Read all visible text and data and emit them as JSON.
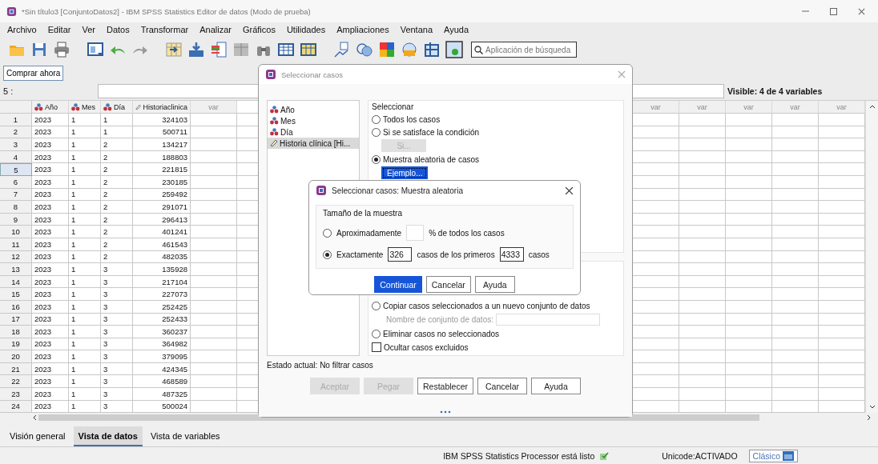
{
  "window": {
    "title": "*Sin título3 [ConjuntoDatos2] - IBM SPSS Statistics Editor de datos (Modo de prueba)"
  },
  "menu": [
    "Archivo",
    "Editar",
    "Ver",
    "Datos",
    "Transformar",
    "Analizar",
    "Gráficos",
    "Utilidades",
    "Ampliaciones",
    "Ventana",
    "Ayuda"
  ],
  "search": {
    "placeholder": "Aplicación de búsqueda"
  },
  "buy_button": "Comprar ahora",
  "cell_editor": {
    "label": "5 :",
    "visible_info": "Visible: 4 de 4 variables"
  },
  "grid": {
    "columns": [
      {
        "name": "Año",
        "kind": "nominal"
      },
      {
        "name": "Mes",
        "kind": "nominal"
      },
      {
        "name": "Día",
        "kind": "nominal"
      },
      {
        "name": "Historiaclinica",
        "kind": "scale"
      },
      {
        "name": "var",
        "kind": "empty"
      }
    ],
    "right_columns": [
      "var",
      "var",
      "var",
      "var",
      "var"
    ],
    "rows": [
      {
        "number": "1",
        "selected": false,
        "cells": [
          "2023",
          "1",
          "1",
          "324103"
        ]
      },
      {
        "number": "2",
        "selected": false,
        "cells": [
          "2023",
          "1",
          "1",
          "500711"
        ]
      },
      {
        "number": "3",
        "selected": false,
        "cells": [
          "2023",
          "1",
          "2",
          "134217"
        ]
      },
      {
        "number": "4",
        "selected": false,
        "cells": [
          "2023",
          "1",
          "2",
          "188803"
        ]
      },
      {
        "number": "5",
        "selected": true,
        "cells": [
          "2023",
          "1",
          "2",
          "221815"
        ]
      },
      {
        "number": "6",
        "selected": false,
        "cells": [
          "2023",
          "1",
          "2",
          "230185"
        ]
      },
      {
        "number": "7",
        "selected": false,
        "cells": [
          "2023",
          "1",
          "2",
          "259492"
        ]
      },
      {
        "number": "8",
        "selected": false,
        "cells": [
          "2023",
          "1",
          "2",
          "291071"
        ]
      },
      {
        "number": "9",
        "selected": false,
        "cells": [
          "2023",
          "1",
          "2",
          "296413"
        ]
      },
      {
        "number": "10",
        "selected": false,
        "cells": [
          "2023",
          "1",
          "2",
          "401241"
        ]
      },
      {
        "number": "11",
        "selected": false,
        "cells": [
          "2023",
          "1",
          "2",
          "461543"
        ]
      },
      {
        "number": "12",
        "selected": false,
        "cells": [
          "2023",
          "1",
          "2",
          "482035"
        ]
      },
      {
        "number": "13",
        "selected": false,
        "cells": [
          "2023",
          "1",
          "3",
          "135928"
        ]
      },
      {
        "number": "14",
        "selected": false,
        "cells": [
          "2023",
          "1",
          "3",
          "217104"
        ]
      },
      {
        "number": "15",
        "selected": false,
        "cells": [
          "2023",
          "1",
          "3",
          "227073"
        ]
      },
      {
        "number": "16",
        "selected": false,
        "cells": [
          "2023",
          "1",
          "3",
          "252425"
        ]
      },
      {
        "number": "17",
        "selected": false,
        "cells": [
          "2023",
          "1",
          "3",
          "252433"
        ]
      },
      {
        "number": "18",
        "selected": false,
        "cells": [
          "2023",
          "1",
          "3",
          "360237"
        ]
      },
      {
        "number": "19",
        "selected": false,
        "cells": [
          "2023",
          "1",
          "3",
          "364982"
        ]
      },
      {
        "number": "20",
        "selected": false,
        "cells": [
          "2023",
          "1",
          "3",
          "379095"
        ]
      },
      {
        "number": "21",
        "selected": false,
        "cells": [
          "2023",
          "1",
          "3",
          "424345"
        ]
      },
      {
        "number": "22",
        "selected": false,
        "cells": [
          "2023",
          "1",
          "3",
          "468589"
        ]
      },
      {
        "number": "23",
        "selected": false,
        "cells": [
          "2023",
          "1",
          "3",
          "487325"
        ]
      },
      {
        "number": "24",
        "selected": false,
        "cells": [
          "2023",
          "1",
          "3",
          "500024"
        ]
      }
    ]
  },
  "view_tabs": [
    {
      "label": "Visión general",
      "selected": false
    },
    {
      "label": "Vista de datos",
      "selected": true
    },
    {
      "label": "Vista de variables",
      "selected": false
    }
  ],
  "status_bar": {
    "processor": "IBM SPSS Statistics Processor está listo",
    "unicode": "Unicode:ACTIVADO",
    "mode_button": "Clásico"
  },
  "select_cases_dialog": {
    "title": "Seleccionar casos",
    "variables": [
      {
        "label": "Año",
        "kind": "nominal",
        "selected": false
      },
      {
        "label": "Mes",
        "kind": "nominal",
        "selected": false
      },
      {
        "label": "Día",
        "kind": "nominal",
        "selected": false
      },
      {
        "label": "Historia clínica [Hi...",
        "kind": "scale",
        "selected": true
      }
    ],
    "select_title": "Seleccionar",
    "select_options": [
      {
        "label": "Todos los casos",
        "selected": false
      },
      {
        "label": "Si se satisface la condición",
        "selected": false,
        "button": {
          "label": "Si...",
          "disabled": true,
          "focused": false
        }
      },
      {
        "label": "Muestra aleatoria de casos",
        "selected": true,
        "button": {
          "label": "Ejemplo...",
          "disabled": false,
          "focused": true
        }
      }
    ],
    "output_options": [
      {
        "label": "Copiar casos seleccionados a un nuevo conjunto de datos",
        "selected": false,
        "field_label": "Nombre de conjunto de datos:"
      },
      {
        "label": "Eliminar casos no seleccionados",
        "selected": false
      }
    ],
    "hide_excluded": {
      "label": "Ocultar casos excluidos",
      "checked": false
    },
    "status": "Estado actual: No filtrar casos",
    "buttons": [
      {
        "label": "Aceptar",
        "disabled": true
      },
      {
        "label": "Pegar",
        "disabled": true
      },
      {
        "label": "Restablecer",
        "disabled": false
      },
      {
        "label": "Cancelar",
        "disabled": false
      },
      {
        "label": "Ayuda",
        "disabled": false
      }
    ]
  },
  "random_sample_dialog": {
    "title": "Seleccionar casos: Muestra aleatoria",
    "group_title": "Tamaño de la muestra",
    "options": [
      {
        "kind": "percent",
        "label": "Aproximadamente",
        "selected": false,
        "suffix": "% de todos los casos"
      },
      {
        "kind": "exact",
        "label": "Exactamente",
        "selected": true,
        "value": "326",
        "middle": "casos de los primeros",
        "value2": "4333",
        "suffix": "casos"
      }
    ],
    "buttons": [
      {
        "label": "Continuar",
        "primary": true
      },
      {
        "label": "Cancelar",
        "primary": false
      },
      {
        "label": "Ayuda",
        "primary": false
      }
    ]
  }
}
